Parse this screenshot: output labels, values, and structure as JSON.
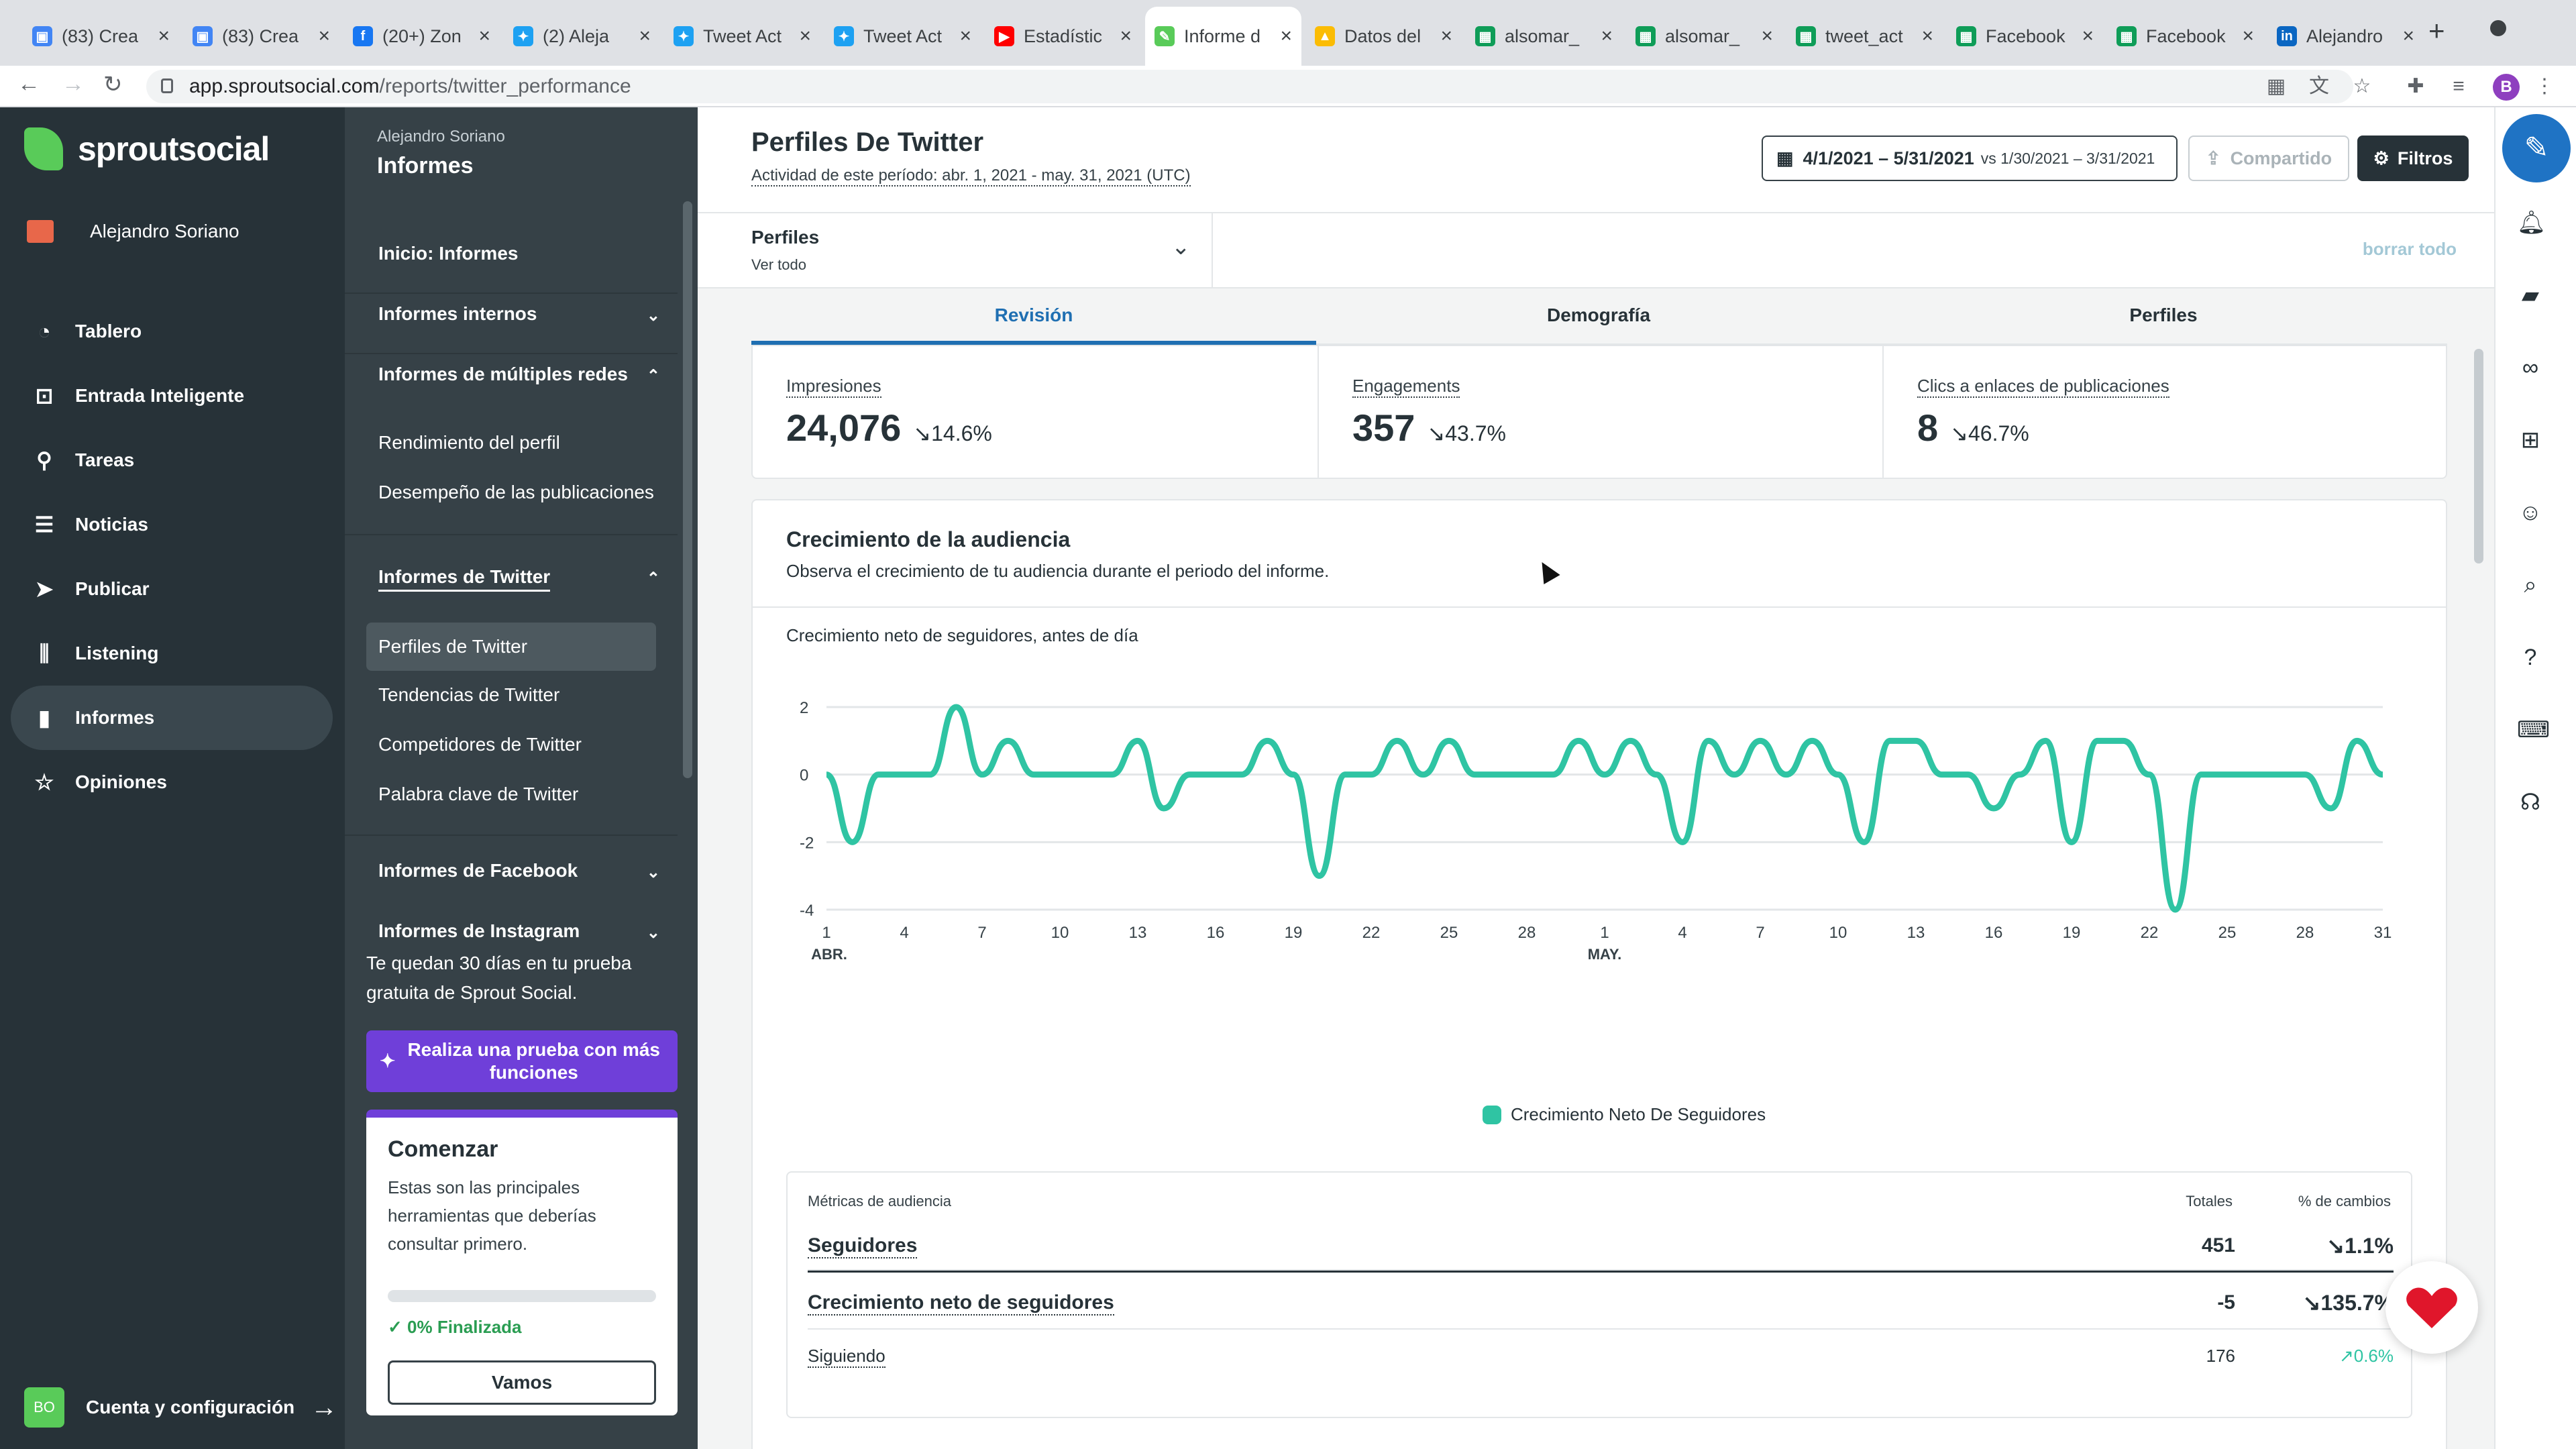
{
  "browser": {
    "tabs": [
      {
        "label": "(83) Crea",
        "fav_color": "#4285f4",
        "fav_glyph": "▣"
      },
      {
        "label": "(83) Crea",
        "fav_color": "#4285f4",
        "fav_glyph": "▣"
      },
      {
        "label": "(20+) Zon",
        "fav_color": "#1877f2",
        "fav_glyph": "f"
      },
      {
        "label": "(2) Aleja",
        "fav_color": "#1da1f2",
        "fav_glyph": "✦"
      },
      {
        "label": "Tweet Act",
        "fav_color": "#1da1f2",
        "fav_glyph": "✦"
      },
      {
        "label": "Tweet Act",
        "fav_color": "#1da1f2",
        "fav_glyph": "✦"
      },
      {
        "label": "Estadístic",
        "fav_color": "#ff0000",
        "fav_glyph": "▶"
      },
      {
        "label": "Informe d",
        "fav_color": "#59cb59",
        "fav_glyph": "✎",
        "active": true
      },
      {
        "label": "Datos del",
        "fav_color": "#fbbc04",
        "fav_glyph": "▲"
      },
      {
        "label": "alsomar_",
        "fav_color": "#0f9d58",
        "fav_glyph": "▦"
      },
      {
        "label": "alsomar_",
        "fav_color": "#0f9d58",
        "fav_glyph": "▦"
      },
      {
        "label": "tweet_act",
        "fav_color": "#0f9d58",
        "fav_glyph": "▦"
      },
      {
        "label": "Facebook",
        "fav_color": "#0f9d58",
        "fav_glyph": "▦"
      },
      {
        "label": "Facebook",
        "fav_color": "#0f9d58",
        "fav_glyph": "▦"
      },
      {
        "label": "Alejandro",
        "fav_color": "#0a66c2",
        "fav_glyph": "in"
      }
    ],
    "url_host": "app.sproutsocial.com",
    "url_path": "/reports/twitter_performance",
    "profile_initial": "B"
  },
  "leftnav": {
    "brand": "sproutsocial",
    "user": "Alejandro Soriano",
    "items": [
      {
        "label": "Tablero",
        "icon": "dashboard-icon",
        "glyph": "◔"
      },
      {
        "label": "Entrada Inteligente",
        "icon": "inbox-icon",
        "glyph": "⊡"
      },
      {
        "label": "Tareas",
        "icon": "pin-icon",
        "glyph": "⚲"
      },
      {
        "label": "Noticias",
        "icon": "list-icon",
        "glyph": "☰"
      },
      {
        "label": "Publicar",
        "icon": "send-icon",
        "glyph": "➤"
      },
      {
        "label": "Listening",
        "icon": "waveform-icon",
        "glyph": "⫼"
      },
      {
        "label": "Informes",
        "icon": "bar-chart-icon",
        "glyph": "▮",
        "active": true
      },
      {
        "label": "Opiniones",
        "icon": "star-icon",
        "glyph": "☆"
      }
    ],
    "account": {
      "initials": "BO",
      "label": "Cuenta y configuración"
    }
  },
  "subnav": {
    "user": "Alejandro Soriano",
    "title": "Informes",
    "home": "Inicio: Informes",
    "sections": {
      "internal": "Informes internos",
      "multi": "Informes de múltiples redes",
      "twitter": "Informes de Twitter",
      "facebook": "Informes de Facebook",
      "instagram": "Informes de Instagram"
    },
    "multi_links": [
      "Rendimiento del perfil",
      "Desempeño de las publicaciones"
    ],
    "twitter_links": [
      "Perfiles de Twitter",
      "Tendencias de Twitter",
      "Competidores de Twitter",
      "Palabra clave de Twitter"
    ],
    "trial_text": "Te quedan 30 días en tu prueba gratuita de Sprout Social.",
    "trial_button": "Realiza una prueba con más funciones",
    "start": {
      "title": "Comenzar",
      "text": "Estas son las principales herramientas que deberías consultar primero.",
      "progress": 0,
      "progress_label": "0% Finalizada",
      "button": "Vamos"
    }
  },
  "header": {
    "title": "Perfiles De Twitter",
    "subtitle": "Actividad de este período: abr. 1, 2021 - may. 31, 2021 (UTC)",
    "date_range": "4/1/2021 – 5/31/2021",
    "compare": "vs 1/30/2021 – 3/31/2021",
    "share": "Compartido",
    "filters": "Filtros"
  },
  "profiles": {
    "label": "Perfiles",
    "value": "Ver todo",
    "clear": "borrar todo"
  },
  "tabs": [
    "Revisión",
    "Demografía",
    "Perfiles"
  ],
  "kpis": [
    {
      "label": "Impresiones",
      "value": "24,076",
      "change": "↘14.6%"
    },
    {
      "label": "Engagements",
      "value": "357",
      "change": "↘43.7%"
    },
    {
      "label": "Clics a enlaces de publicaciones",
      "value": "8",
      "change": "↘46.7%"
    }
  ],
  "growth": {
    "title": "Crecimiento de la audiencia",
    "subtitle": "Observa el crecimiento de tu audiencia durante el periodo del informe.",
    "chart_subtitle": "Crecimiento neto de seguidores, antes de día",
    "legend": "Crecimiento Neto De Seguidores"
  },
  "chart_data": {
    "type": "line",
    "ylim": [
      -4,
      2
    ],
    "yticks": [
      "2",
      "0",
      "-2",
      "-4"
    ],
    "x_tick_labels": [
      "1",
      "4",
      "7",
      "10",
      "13",
      "16",
      "19",
      "22",
      "25",
      "28",
      "1",
      "4",
      "7",
      "10",
      "13",
      "16",
      "19",
      "22",
      "25",
      "28",
      "31"
    ],
    "month_labels": [
      "ABR.",
      "MAY."
    ],
    "grid": true,
    "color": "#2fc4a3",
    "series": [
      {
        "name": "Crecimiento Neto De Seguidores",
        "values": [
          0,
          -2,
          0,
          0,
          0,
          0,
          2,
          0,
          1,
          0,
          0,
          0,
          0,
          1,
          0,
          -1,
          0,
          0,
          0,
          1,
          0,
          -3,
          0,
          0,
          0,
          1,
          0,
          1,
          0,
          0,
          0,
          0,
          1,
          0,
          0,
          1,
          0,
          -2,
          1,
          0,
          1,
          0,
          1,
          1,
          0,
          -2,
          1,
          1,
          0,
          0,
          -1,
          0,
          1,
          0,
          -2,
          1,
          1,
          0,
          -4,
          0,
          0,
          0,
          0,
          0,
          0,
          -1,
          1,
          0
        ],
        "x_days": [
          1,
          2,
          3,
          4,
          5,
          6,
          7,
          8,
          9,
          10,
          11,
          12,
          13,
          14,
          15,
          16,
          17,
          18,
          19,
          20,
          21,
          22,
          23,
          24,
          25,
          26,
          27,
          28,
          29,
          30,
          31,
          32,
          33,
          34,
          35,
          36,
          37,
          38,
          39,
          40,
          41,
          42,
          43,
          44,
          45,
          46,
          47,
          48,
          49,
          50,
          51,
          52,
          53,
          54,
          55,
          56,
          57,
          58,
          59,
          60,
          61
        ]
      }
    ]
  },
  "metrics": {
    "headers": {
      "name": "Métricas de audiencia",
      "total": "Totales",
      "change": "% de cambios"
    },
    "rows": [
      {
        "name": "Seguidores",
        "total": "451",
        "change": "↘1.1%"
      },
      {
        "name": "Crecimiento neto de seguidores",
        "total": "-5",
        "change": "↘135.7%"
      },
      {
        "name": "Siguiendo",
        "total": "176",
        "change": "↗0.6%"
      }
    ]
  }
}
